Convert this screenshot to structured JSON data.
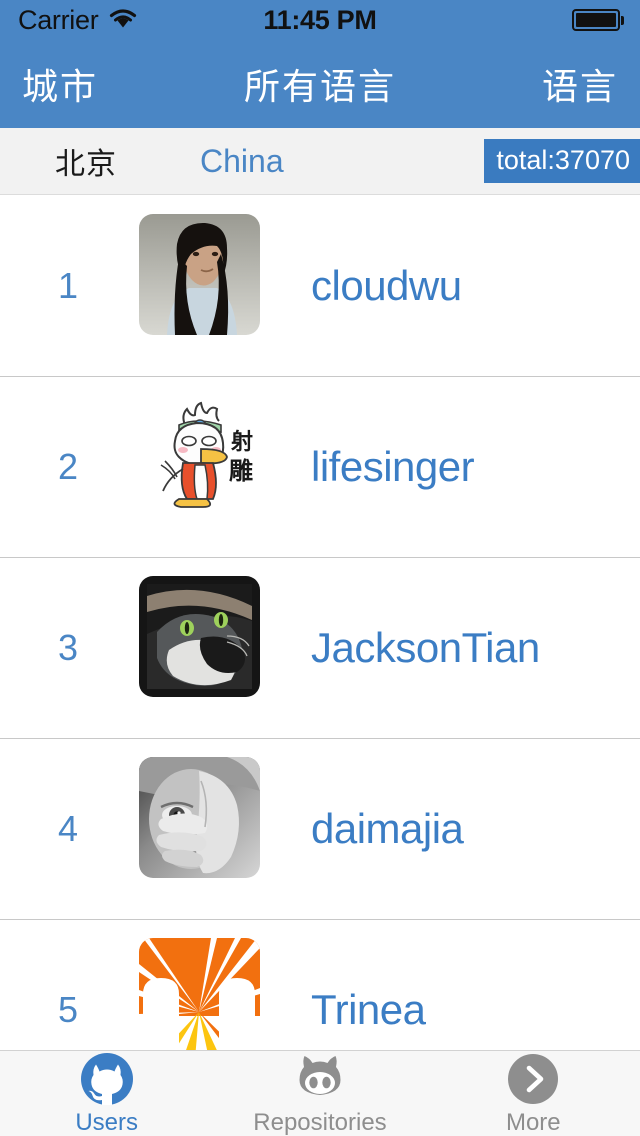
{
  "status_bar": {
    "carrier": "Carrier",
    "wifi_icon": "wifi-icon",
    "time": "11:45 PM",
    "battery_icon": "battery-full-icon"
  },
  "nav_bar": {
    "back_label": "城市",
    "title": "所有语言",
    "right_label": "语言"
  },
  "sub_header": {
    "city": "北京",
    "country": "China",
    "total": "total:37070"
  },
  "list": {
    "rows": [
      {
        "rank": "1",
        "username": "cloudwu",
        "avatar_icon": "avatar-portrait-long-hair"
      },
      {
        "rank": "2",
        "username": "lifesinger",
        "avatar_icon": "avatar-cartoon-eagle"
      },
      {
        "rank": "3",
        "username": "JacksonTian",
        "avatar_icon": "avatar-dark-cat"
      },
      {
        "rank": "4",
        "username": "daimajia",
        "avatar_icon": "avatar-bw-face-hand"
      },
      {
        "rank": "5",
        "username": "Trinea",
        "avatar_icon": "avatar-orange-sunburst"
      }
    ]
  },
  "tab_bar": {
    "tabs": [
      {
        "label": "Users",
        "icon": "github-octocat-circle-icon",
        "active": true
      },
      {
        "label": "Repositories",
        "icon": "octocat-head-icon",
        "active": false
      },
      {
        "label": "More",
        "icon": "chevron-right-circle-icon",
        "active": false
      }
    ]
  },
  "colors": {
    "nav_blue": "#4a86c5",
    "link_blue": "#3b7dc4",
    "badge_blue": "#3a7bc0",
    "subheader_gray": "#f2f2f2",
    "tabbar_gray": "#f7f7f7",
    "inactive_gray": "#8e8e8e"
  }
}
